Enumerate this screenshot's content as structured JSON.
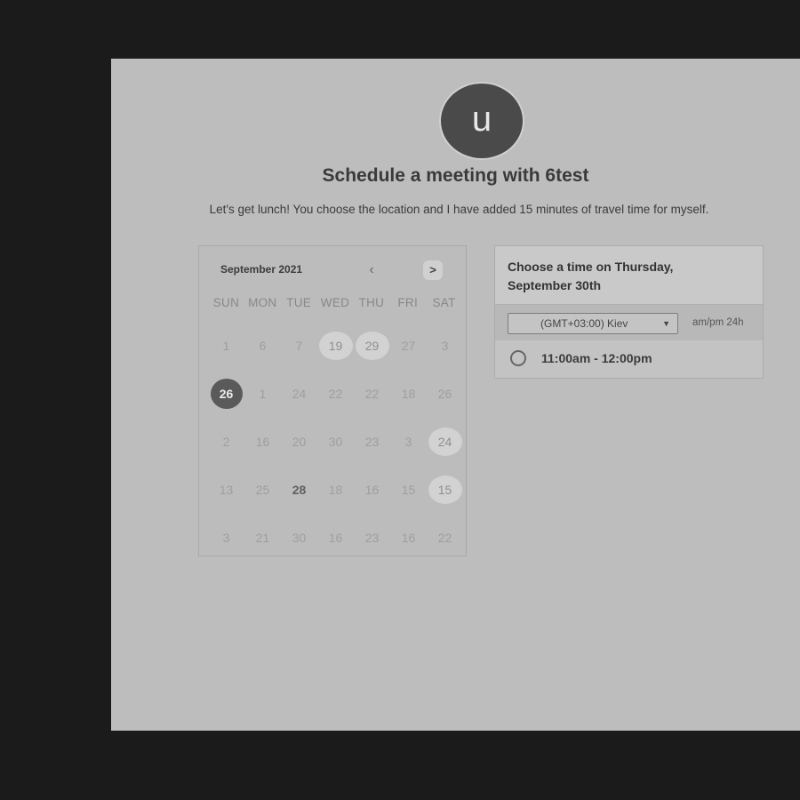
{
  "header": {
    "avatar_letter": "u",
    "title": "Schedule a meeting with 6test",
    "description": "Let's get lunch! You choose the location and I have added 15 minutes of travel time for myself."
  },
  "calendar": {
    "month_label": "September 2021",
    "prev_icon": "chevron-left-icon",
    "next_icon": "chevron-right-icon",
    "weekdays": [
      "SUN",
      "MON",
      "TUE",
      "WED",
      "THU",
      "FRI",
      "SAT"
    ],
    "weeks": [
      [
        "1",
        "6",
        "7",
        "19",
        "29",
        "27",
        "3"
      ],
      [
        "26",
        "1",
        "24",
        "22",
        "22",
        "18",
        "26"
      ],
      [
        "2",
        "16",
        "20",
        "30",
        "23",
        "3",
        "24"
      ],
      [
        "13",
        "25",
        "28",
        "18",
        "16",
        "15",
        "15"
      ],
      [
        "3",
        "21",
        "30",
        "16",
        "23",
        "16",
        "22"
      ]
    ]
  },
  "times": {
    "heading": "Choose a time on Thursday, September 30th",
    "timezone": "(GMT+03:00) Kiev",
    "format_options": "am/pm  24h",
    "slots": [
      "11:00am - 12:00pm"
    ]
  },
  "colors": {
    "background": "#1b1b1b",
    "panel": "#bdbdbd",
    "selected_day": "#5a5a5a",
    "available_day": "#d2d2d2"
  }
}
